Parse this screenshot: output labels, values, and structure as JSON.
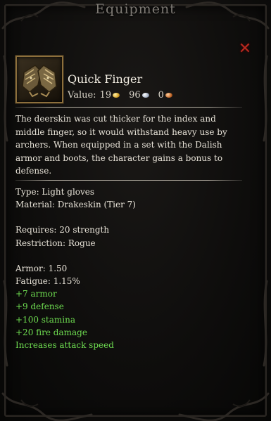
{
  "window": {
    "title": "Equipment"
  },
  "item": {
    "name": "Quick Finger",
    "icon": "gloves-icon",
    "value": {
      "label": "Value:",
      "gold": "19",
      "silver": "96",
      "copper": "0"
    },
    "description": "The deerskin was cut thicker for the index and middle finger, so it would withstand heavy use by archers. When equipped in a set with the Dalish armor and boots, the character gains a bonus to defense.",
    "type": "Type: Light gloves",
    "material": "Material: Drakeskin (Tier 7)",
    "requires": "Requires: 20 strength",
    "restriction": "Restriction: Rogue",
    "armor": "Armor: 1.50",
    "fatigue": "Fatigue: 1.15%",
    "bonuses": [
      "+7 armor",
      "+9 defense",
      "+100 stamina",
      "+20 fire damage",
      "Increases attack speed"
    ]
  },
  "colors": {
    "bonus": "#6edc50",
    "close": "#b8291f",
    "icon_border": "#8c6f3c"
  }
}
